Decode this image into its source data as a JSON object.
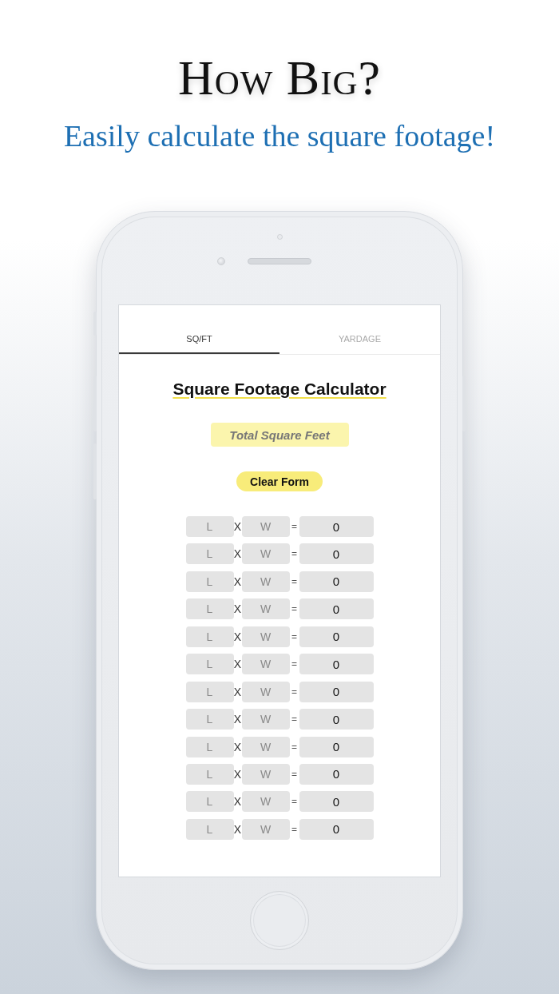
{
  "headline": "How Big?",
  "subtitle": "Easily calculate the square footage!",
  "phone": {
    "tabs": [
      {
        "label": "SQ/FT",
        "selected": true
      },
      {
        "label": "YARDAGE",
        "selected": false
      }
    ],
    "title": "Square Footage Calculator",
    "total_field": {
      "placeholder": "Total Square Feet"
    },
    "clear_button": "Clear Form",
    "rows": [
      {
        "length_placeholder": "L",
        "times": "X",
        "width_placeholder": "W",
        "equals": "=",
        "result": "0"
      },
      {
        "length_placeholder": "L",
        "times": "X",
        "width_placeholder": "W",
        "equals": "=",
        "result": "0"
      },
      {
        "length_placeholder": "L",
        "times": "X",
        "width_placeholder": "W",
        "equals": "=",
        "result": "0"
      },
      {
        "length_placeholder": "L",
        "times": "X",
        "width_placeholder": "W",
        "equals": "=",
        "result": "0"
      },
      {
        "length_placeholder": "L",
        "times": "X",
        "width_placeholder": "W",
        "equals": "=",
        "result": "0"
      },
      {
        "length_placeholder": "L",
        "times": "X",
        "width_placeholder": "W",
        "equals": "=",
        "result": "0"
      },
      {
        "length_placeholder": "L",
        "times": "X",
        "width_placeholder": "W",
        "equals": "=",
        "result": "0"
      },
      {
        "length_placeholder": "L",
        "times": "X",
        "width_placeholder": "W",
        "equals": "=",
        "result": "0"
      },
      {
        "length_placeholder": "L",
        "times": "X",
        "width_placeholder": "W",
        "equals": "=",
        "result": "0"
      },
      {
        "length_placeholder": "L",
        "times": "X",
        "width_placeholder": "W",
        "equals": "=",
        "result": "0"
      },
      {
        "length_placeholder": "L",
        "times": "X",
        "width_placeholder": "W",
        "equals": "=",
        "result": "0"
      },
      {
        "length_placeholder": "L",
        "times": "X",
        "width_placeholder": "W",
        "equals": "=",
        "result": "0"
      }
    ]
  }
}
